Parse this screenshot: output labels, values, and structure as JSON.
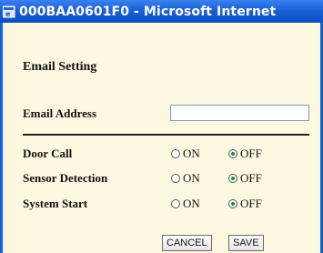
{
  "window": {
    "title": "000BAA0601F0 - Microsoft Internet"
  },
  "form": {
    "heading": "Email Setting",
    "email_label": "Email Address",
    "email_value": "",
    "rows": [
      {
        "label": "Door Call",
        "on_label": "ON",
        "off_label": "OFF",
        "selected": "OFF"
      },
      {
        "label": "Sensor Detection",
        "on_label": "ON",
        "off_label": "OFF",
        "selected": "OFF"
      },
      {
        "label": "System Start",
        "on_label": "ON",
        "off_label": "OFF",
        "selected": "OFF"
      }
    ],
    "cancel_label": "CANCEL",
    "save_label": "SAVE"
  }
}
